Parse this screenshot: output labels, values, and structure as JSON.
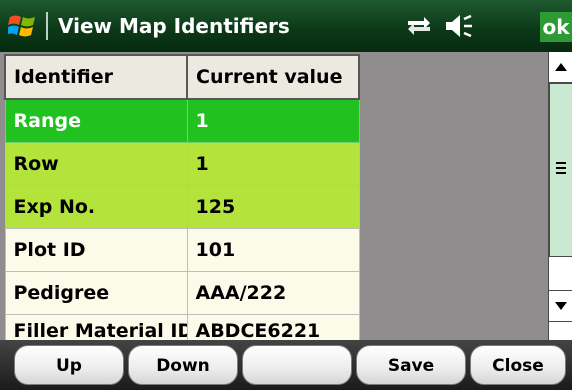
{
  "titlebar": {
    "title": "View Map Identifiers",
    "ok_label": "ok",
    "icons": {
      "start": "windows-logo-icon",
      "connectivity": "connectivity-icon",
      "volume": "volume-icon"
    }
  },
  "grid": {
    "headers": [
      "Identifier",
      "Current value"
    ],
    "rows": [
      {
        "identifier": "Range",
        "value": "1"
      },
      {
        "identifier": "Row",
        "value": "1"
      },
      {
        "identifier": "Exp No.",
        "value": "125"
      },
      {
        "identifier": "Plot ID",
        "value": "101"
      },
      {
        "identifier": "Pedigree",
        "value": "AAA/222"
      },
      {
        "identifier": "Filler Material ID",
        "value": "ABDCE6221"
      }
    ]
  },
  "buttons": {
    "up": "Up",
    "down": "Down",
    "blank": "",
    "save": "Save",
    "close": "Close"
  },
  "colors": {
    "titlebar": "#0c3a19",
    "ok_button": "#2d9a36",
    "selected_row": "#21c21f",
    "highlight_row": "#b4e33b",
    "plain_row": "#fcfbe9"
  }
}
